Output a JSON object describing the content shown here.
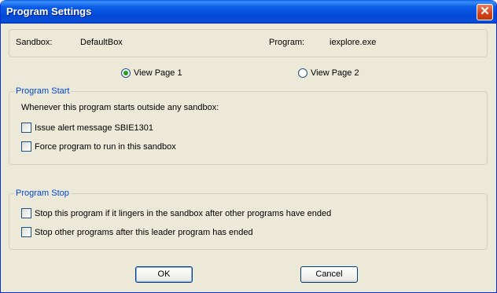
{
  "window": {
    "title": "Program Settings"
  },
  "info": {
    "sandbox_label": "Sandbox:",
    "sandbox_value": "DefaultBox",
    "program_label": "Program:",
    "program_value": "iexplore.exe"
  },
  "view": {
    "page1_label": "View Page 1",
    "page2_label": "View Page 2",
    "selected": "View Page 1"
  },
  "program_start": {
    "title": "Program Start",
    "description": "Whenever this program starts outside any sandbox:",
    "options": [
      {
        "label": "Issue alert message SBIE1301",
        "checked": false
      },
      {
        "label": "Force program to run in this sandbox",
        "checked": false
      }
    ]
  },
  "program_stop": {
    "title": "Program Stop",
    "options": [
      {
        "label": "Stop this program if it lingers in the sandbox after other programs have ended",
        "checked": false
      },
      {
        "label": "Stop other programs after this leader program has ended",
        "checked": false
      }
    ]
  },
  "buttons": {
    "ok_label": "OK",
    "cancel_label": "Cancel"
  },
  "colors": {
    "titlebar": "#0a5ce6",
    "dialog_bg": "#ece9d8",
    "group_title": "#0046d5"
  }
}
